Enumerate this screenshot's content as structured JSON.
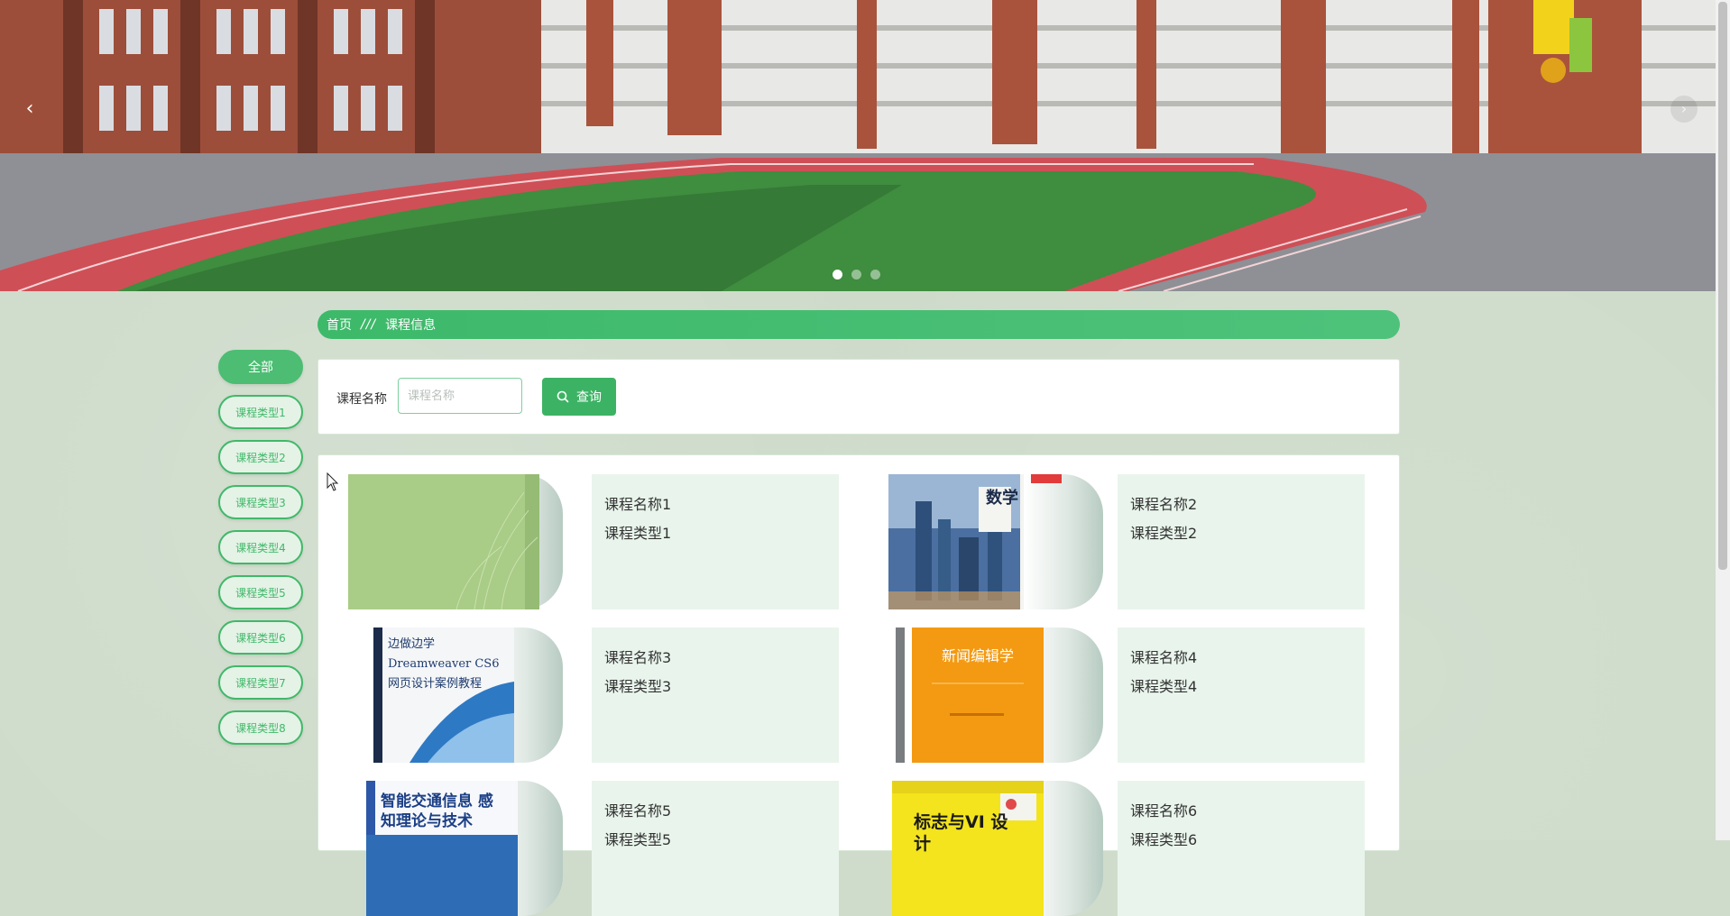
{
  "banner": {
    "prev_icon": "chevron-left-icon",
    "next_icon": "chevron-right-icon",
    "slide_count": 3,
    "active_slide": 1
  },
  "breadcrumb": {
    "home": "首页",
    "separator": "///",
    "current": "课程信息"
  },
  "categories": [
    {
      "label": "全部",
      "active": true
    },
    {
      "label": "课程类型1",
      "active": false
    },
    {
      "label": "课程类型2",
      "active": false
    },
    {
      "label": "课程类型3",
      "active": false
    },
    {
      "label": "课程类型4",
      "active": false
    },
    {
      "label": "课程类型5",
      "active": false
    },
    {
      "label": "课程类型6",
      "active": false
    },
    {
      "label": "课程类型7",
      "active": false
    },
    {
      "label": "课程类型8",
      "active": false
    }
  ],
  "search": {
    "label": "课程名称",
    "placeholder": "课程名称",
    "value": "",
    "button_label": "查询",
    "button_icon": "search-icon"
  },
  "courses": [
    {
      "name": "课程名称1",
      "type": "课程类型1",
      "cover_text": ""
    },
    {
      "name": "课程名称2",
      "type": "课程类型2",
      "cover_text": "数学"
    },
    {
      "name": "课程名称3",
      "type": "课程类型3",
      "cover_text": "边做边学 Dreamweaver CS6 网页设计案例教程"
    },
    {
      "name": "课程名称4",
      "type": "课程类型4",
      "cover_text": "新闻编辑学"
    },
    {
      "name": "课程名称5",
      "type": "课程类型5",
      "cover_text": "智能交通信息 感知理论与技术"
    },
    {
      "name": "课程名称6",
      "type": "课程类型6",
      "cover_text": "标志与VI 设计"
    }
  ],
  "colors": {
    "accent": "#3cb364",
    "page_bg": "#cfdccb",
    "card_bg": "#e9f5ec"
  }
}
